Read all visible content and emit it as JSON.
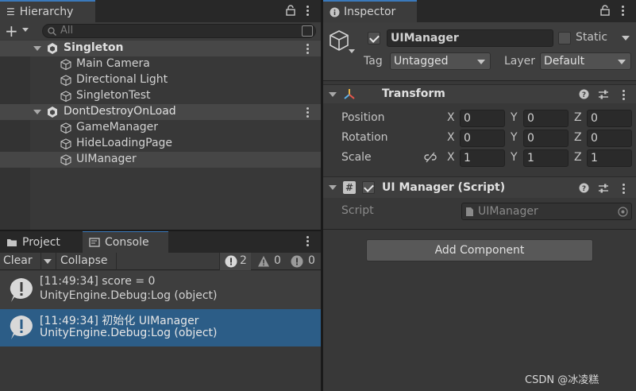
{
  "hierarchy": {
    "tab_label": "Hierarchy",
    "add_label": "+",
    "search_placeholder": "All",
    "scenes": [
      {
        "name": "Singleton",
        "children": [
          "Main Camera",
          "Directional Light",
          "SingletonTest"
        ]
      },
      {
        "name": "DontDestroyOnLoad",
        "children": [
          "GameManager",
          "HideLoadingPage",
          "UIManager"
        ]
      }
    ]
  },
  "bottom_tabs": {
    "project": "Project",
    "console": "Console"
  },
  "console": {
    "clear_label": "Clear",
    "collapse_label": "Collapse",
    "counts": {
      "log": "2",
      "warning": "0",
      "error": "0"
    },
    "entries": [
      {
        "line1": "[11:49:34] score = 0",
        "line2": "UnityEngine.Debug:Log (object)"
      },
      {
        "line1": "[11:49:34] 初始化 UIManager",
        "line2": "UnityEngine.Debug:Log (object)"
      }
    ]
  },
  "inspector": {
    "tab_label": "Inspector",
    "object_name": "UIManager",
    "static_label": "Static",
    "tag_label": "Tag",
    "tag_value": "Untagged",
    "layer_label": "Layer",
    "layer_value": "Default",
    "transform": {
      "title": "Transform",
      "position_label": "Position",
      "rotation_label": "Rotation",
      "scale_label": "Scale",
      "axes": [
        "X",
        "Y",
        "Z"
      ],
      "position": [
        "0",
        "0",
        "0"
      ],
      "rotation": [
        "0",
        "0",
        "0"
      ],
      "scale": [
        "1",
        "1",
        "1"
      ]
    },
    "script_component": {
      "title": "UI Manager (Script)",
      "script_label": "Script",
      "script_value": "UIManager"
    },
    "add_component_label": "Add Component"
  },
  "watermark": "CSDN @冰凌糕",
  "colors": {
    "accent": "#3a79bb",
    "selection": "#2c5d87",
    "panel": "#383838"
  },
  "icons": [
    "hierarchy-icon",
    "lock-icon",
    "unity-scene-icon",
    "gameobject-cube-icon",
    "search-icon",
    "info-icon",
    "transform-icon",
    "script-icon",
    "help-icon",
    "presets-icon",
    "target-icon",
    "link-icon",
    "folder-icon",
    "console-icon"
  ]
}
